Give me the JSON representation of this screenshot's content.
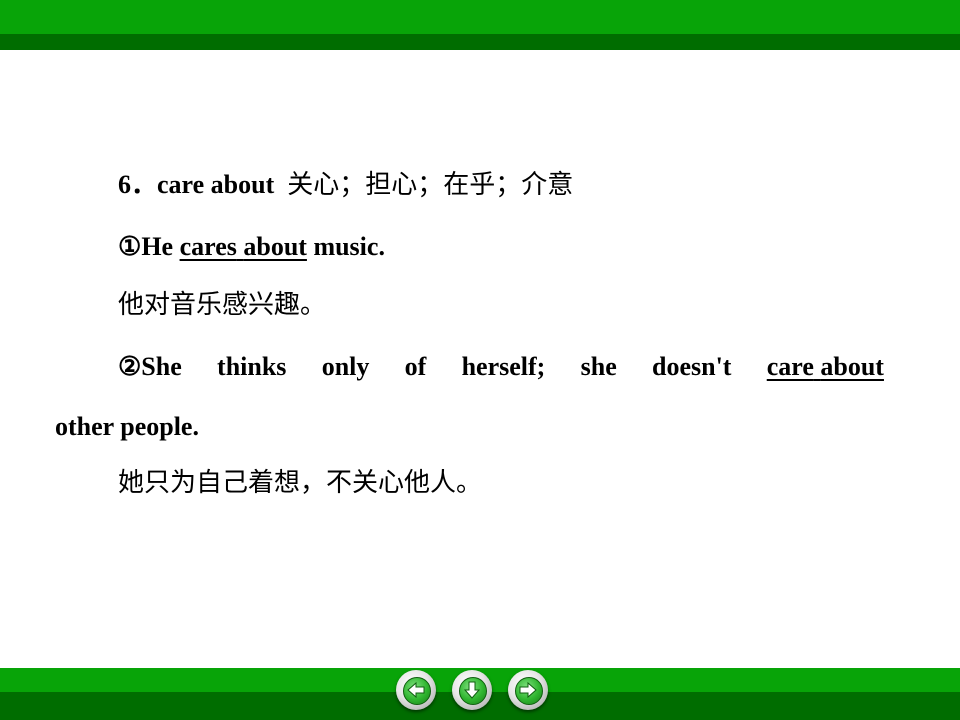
{
  "slide": {
    "heading_number": "6．",
    "heading_phrase": "care about",
    "heading_cn": "关心；担心；在乎；介意",
    "example1": {
      "marker": "①",
      "prefix": "He ",
      "phrase_part1": "cares",
      "phrase_part2": "about",
      "suffix": " music."
    },
    "example1_cn": "他对音乐感兴趣。",
    "example2": {
      "words": [
        "②She",
        "thinks",
        "only",
        "of",
        "herself;",
        "she",
        "doesn't"
      ],
      "phrase_part1": "care",
      "phrase_part2": "about",
      "continuation": "other people."
    },
    "example2_cn": "她只为自己着想，不关心他人。"
  },
  "nav": {
    "prev_icon": "arrow-left-icon",
    "home_icon": "arrow-down-icon",
    "next_icon": "arrow-right-icon",
    "accent": "#08a408",
    "accent_dark": "#006d00"
  }
}
